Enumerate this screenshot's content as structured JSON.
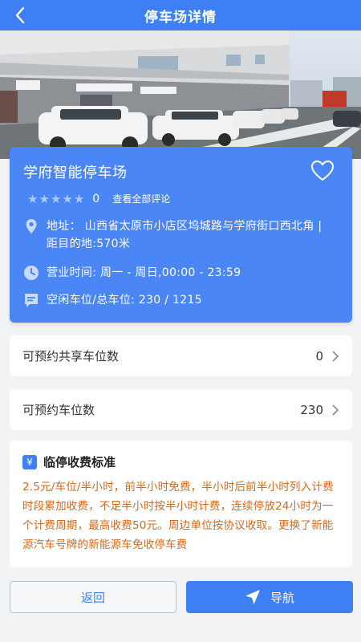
{
  "header": {
    "title": "停车场详情"
  },
  "lot": {
    "name": "学府智能停车场",
    "rating": 0,
    "rating_max": 5,
    "review_count": "0",
    "view_reviews_label": "查看全部评论",
    "address": "地址：  山西省太原市小店区坞城路与学府街口西北角 | 距目的地:570米",
    "hours": "营业时间:   周一 - 周日,00:00 - 23:59",
    "spaces": "空闲车位/总车位:   230 / 1215"
  },
  "rows": {
    "shared_label": "可预约共享车位数",
    "shared_value": "0",
    "reserve_label": "可预约车位数",
    "reserve_value": "230"
  },
  "fee": {
    "title": "临停收费标准",
    "badge": "¥",
    "text": "2.5元/车位/半小时，前半小时免费，半小时后前半小时列入计费时段累加收费，不足半小时按半小时计费，连续停放24小时为一个计费周期，最高收费50元。周边单位按协议收取。更换了新能源汽车号牌的新能源车免收停车费"
  },
  "buttons": {
    "back_label": "返回",
    "navigate_label": "导航"
  },
  "colors": {
    "primary": "#3e7ff4",
    "card": "#4a86f5",
    "fee_text": "#d26a1e"
  }
}
